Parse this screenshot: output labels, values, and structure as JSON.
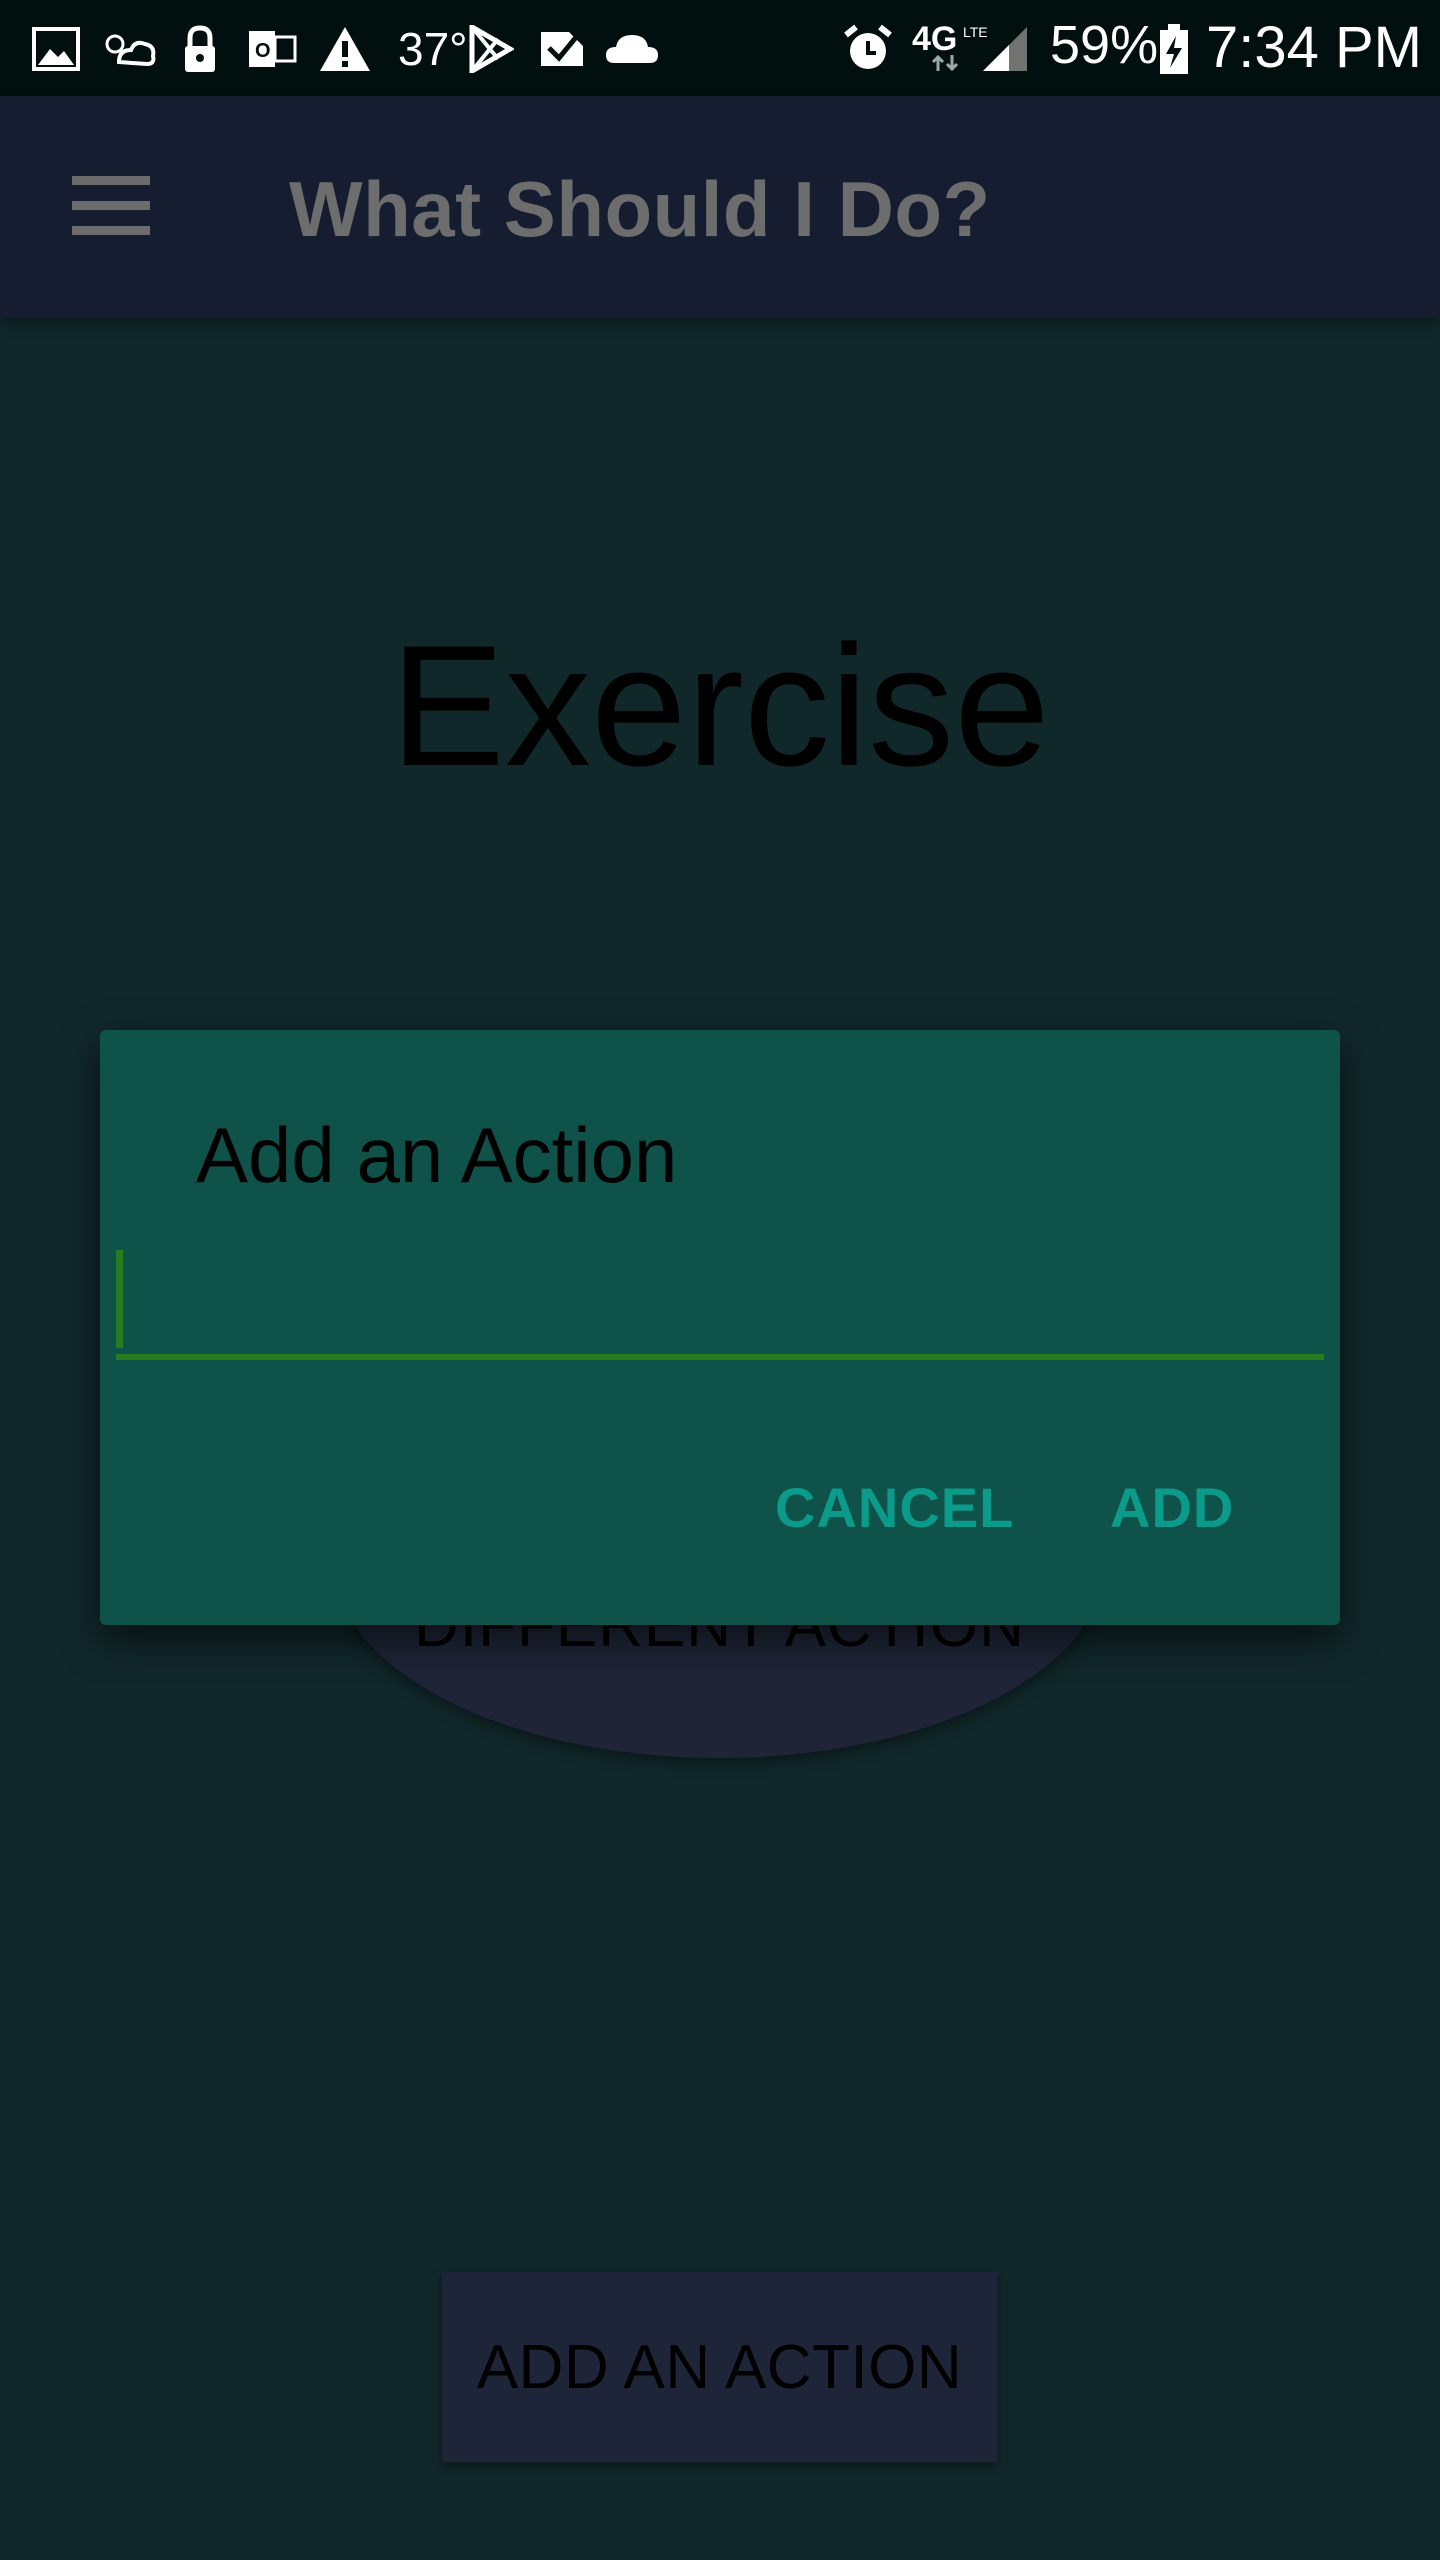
{
  "status_bar": {
    "temperature": "37°",
    "network": "4G",
    "network_sub": "LTE",
    "battery": "59%",
    "time": "7:34 PM"
  },
  "app_bar": {
    "title": "What Should I Do?"
  },
  "main": {
    "current_action": "Exercise",
    "different_action_label": "DIFFERENT ACTION",
    "add_action_label": "ADD AN ACTION"
  },
  "dialog": {
    "title": "Add an Action",
    "input_value": "",
    "cancel_label": "CANCEL",
    "add_label": "ADD"
  },
  "colors": {
    "background": "#11282a",
    "app_bar": "#161d30",
    "dialog": "#0f524a",
    "accent": "#0b9b8a",
    "input_underline": "#2a7a1e"
  }
}
